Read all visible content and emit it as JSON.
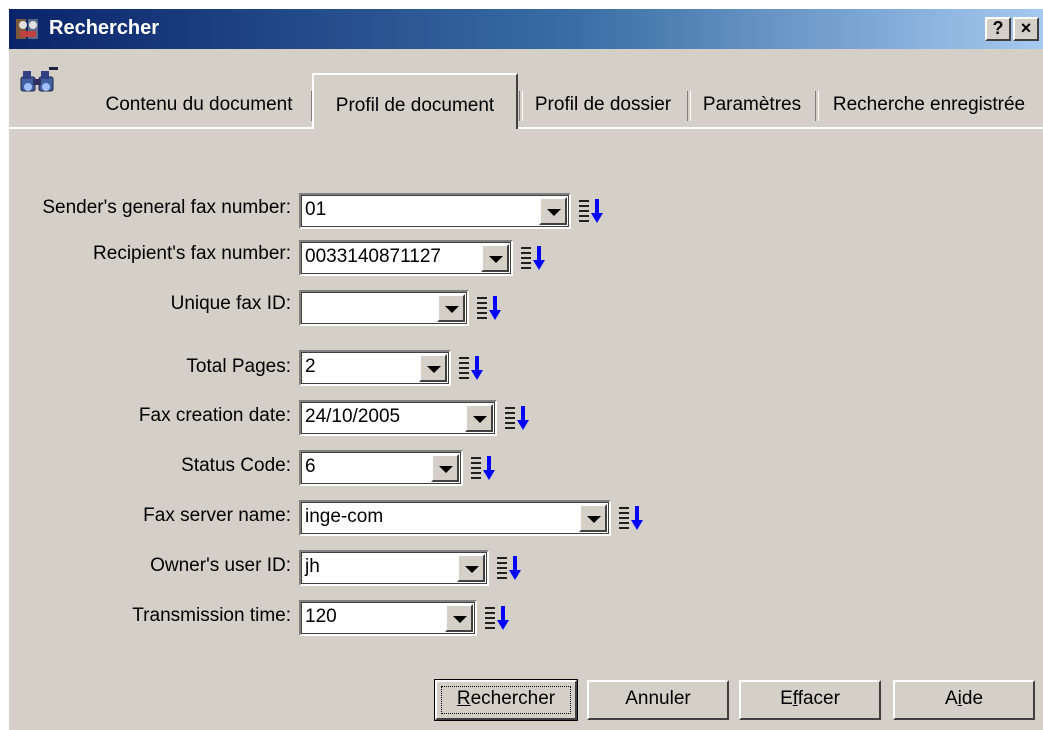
{
  "window": {
    "title": "Rechercher",
    "help_label": "?",
    "close_label": "×"
  },
  "icons": {
    "title_icon": "search-app-icon",
    "binoculars": "binoculars-icon",
    "sort": "sort-descending-icon"
  },
  "tabs": [
    {
      "label": "Contenu du document",
      "active": false
    },
    {
      "label": "Profil de document",
      "active": true
    },
    {
      "label": "Profil de dossier",
      "active": false
    },
    {
      "label": "Paramètres",
      "active": false
    },
    {
      "label": "Recherche enregistrée",
      "active": false
    }
  ],
  "fields": [
    {
      "label": "Sender's general fax number:",
      "value": "01"
    },
    {
      "label": "Recipient's fax number:",
      "value": "0033140871127"
    },
    {
      "label": "Unique fax ID:",
      "value": ""
    },
    {
      "label": "Total Pages:",
      "value": "2"
    },
    {
      "label": "Fax creation date:",
      "value": "24/10/2005"
    },
    {
      "label": "Status Code:",
      "value": "6"
    },
    {
      "label": "Fax server name:",
      "value": "inge-com"
    },
    {
      "label": "Owner's user ID:",
      "value": "jh"
    },
    {
      "label": "Transmission time:",
      "value": "120"
    }
  ],
  "buttons": {
    "search": {
      "mnemonic": "R",
      "rest": "echercher"
    },
    "cancel": "Annuler",
    "clear": {
      "before": "E",
      "mnemonic": "f",
      "rest": "facer"
    },
    "help": {
      "before": "A",
      "mnemonic": "i",
      "rest": "de"
    }
  },
  "colors": {
    "dialog_bg": "#d4d0c8",
    "titlebar_start": "#0a246a",
    "titlebar_end": "#a6caf0",
    "sort_arrow": "#0000ff"
  }
}
